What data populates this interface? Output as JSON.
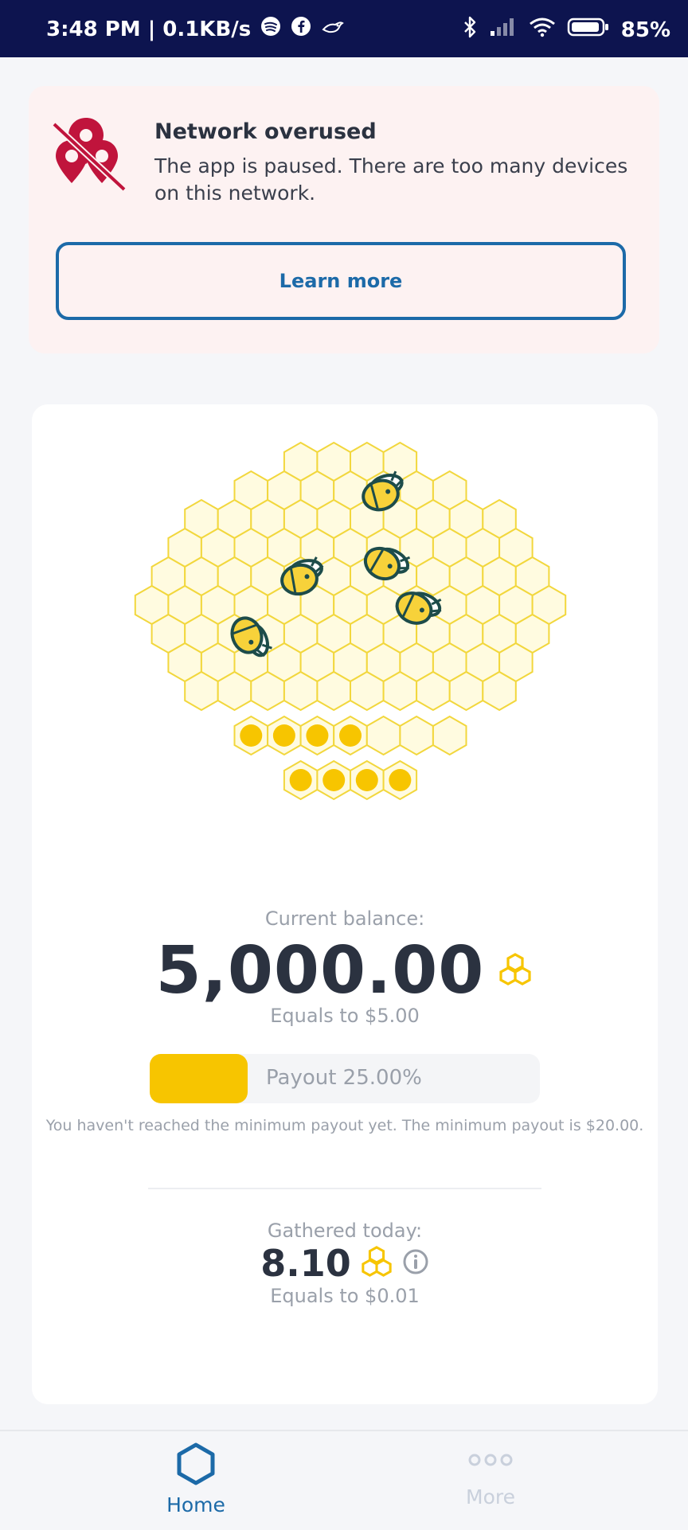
{
  "status_bar": {
    "time_info": "3:48 PM | 0.1KB/s",
    "battery": "85%",
    "icons": [
      "spotify-icon",
      "facebook-icon",
      "bird-icon",
      "bluetooth-icon",
      "signal-icon",
      "wifi-icon",
      "battery-icon"
    ]
  },
  "alert": {
    "title": "Network overused",
    "message": "The app is paused. There are too many devices on this network.",
    "button": "Learn more",
    "icon": "location-off-icon"
  },
  "balance": {
    "label": "Current balance:",
    "value": "5,000.00",
    "equals": "Equals to $5.00"
  },
  "payout": {
    "label": "Payout 25.00%",
    "progress_percent": 25,
    "note": "You haven't reached the minimum payout yet. The minimum payout is $20.00."
  },
  "today": {
    "label": "Gathered today:",
    "value": "8.10",
    "equals": "Equals to $0.01"
  },
  "nav": {
    "home": "Home",
    "more": "More"
  },
  "colors": {
    "status_bar": "#0d144f",
    "accent_blue": "#1c6aa8",
    "honey_yellow": "#f7c500",
    "alert_red": "#c0143c",
    "bee_green": "#1d4c4a"
  }
}
